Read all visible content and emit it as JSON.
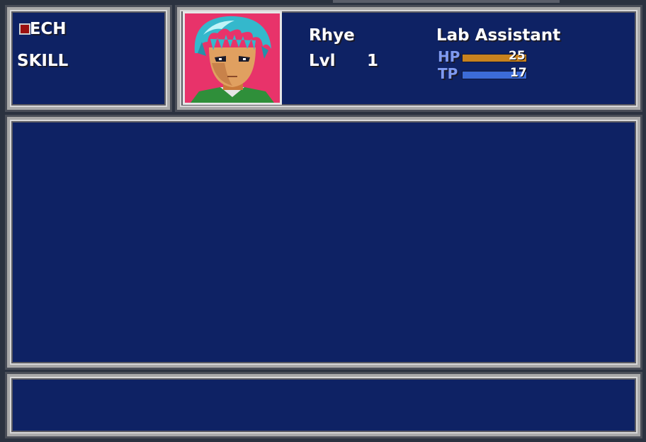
{
  "menu": {
    "item_tech": "TECH",
    "item_skill": "SKILL"
  },
  "character": {
    "name": "Rhye",
    "class": "Lab Assistant",
    "level_label": "Lvl",
    "level_value": "1",
    "hp_label": "HP",
    "hp_value": "25",
    "hp_fill": 1.0,
    "tp_label": "TP",
    "tp_value": "17",
    "tp_fill": 1.0,
    "portrait_icon": "character-portrait"
  },
  "colors": {
    "window_bg": "#0e2264",
    "hp_bar": "#c8821e",
    "tp_bar": "#3c6cd8",
    "portrait_bg": "#e8336a"
  }
}
